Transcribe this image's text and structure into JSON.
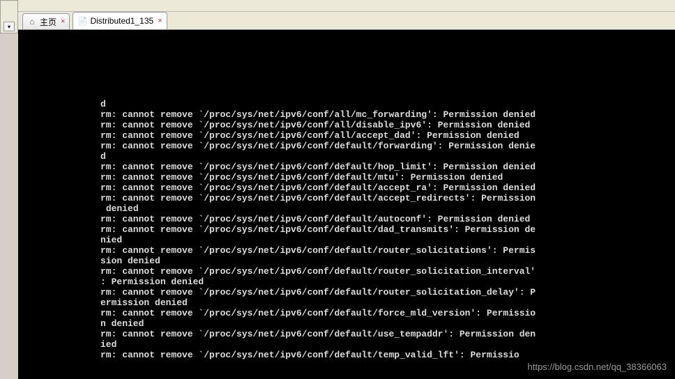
{
  "sidebar": {
    "dropdown_arrow": "▾"
  },
  "tabs": [
    {
      "icon": "⌂",
      "label": "主页",
      "active": false
    },
    {
      "icon": "📄",
      "label": "Distributed1_135",
      "active": true
    }
  ],
  "terminal_lines": [
    "d",
    "rm: cannot remove `/proc/sys/net/ipv6/conf/all/mc_forwarding': Permission denied",
    "rm: cannot remove `/proc/sys/net/ipv6/conf/all/disable_ipv6': Permission denied",
    "rm: cannot remove `/proc/sys/net/ipv6/conf/all/accept_dad': Permission denied",
    "rm: cannot remove `/proc/sys/net/ipv6/conf/default/forwarding': Permission denie",
    "d",
    "rm: cannot remove `/proc/sys/net/ipv6/conf/default/hop_limit': Permission denied",
    "rm: cannot remove `/proc/sys/net/ipv6/conf/default/mtu': Permission denied",
    "rm: cannot remove `/proc/sys/net/ipv6/conf/default/accept_ra': Permission denied",
    "rm: cannot remove `/proc/sys/net/ipv6/conf/default/accept_redirects': Permission",
    " denied",
    "rm: cannot remove `/proc/sys/net/ipv6/conf/default/autoconf': Permission denied",
    "rm: cannot remove `/proc/sys/net/ipv6/conf/default/dad_transmits': Permission de",
    "nied",
    "rm: cannot remove `/proc/sys/net/ipv6/conf/default/router_solicitations': Permis",
    "sion denied",
    "rm: cannot remove `/proc/sys/net/ipv6/conf/default/router_solicitation_interval'",
    ": Permission denied",
    "rm: cannot remove `/proc/sys/net/ipv6/conf/default/router_solicitation_delay': P",
    "ermission denied",
    "rm: cannot remove `/proc/sys/net/ipv6/conf/default/force_mld_version': Permissio",
    "n denied",
    "rm: cannot remove `/proc/sys/net/ipv6/conf/default/use_tempaddr': Permission den",
    "ied",
    "rm: cannot remove `/proc/sys/net/ipv6/conf/default/temp_valid_lft': Permissio"
  ],
  "watermark": "https://blog.csdn.net/qq_38366063"
}
